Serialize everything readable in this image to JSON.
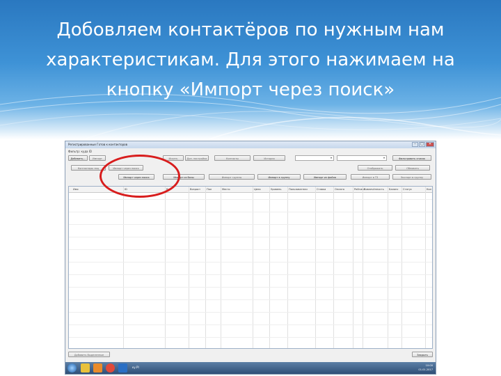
{
  "slide": {
    "title_line1": "Добовляем контактёров по нужным нам",
    "title_line2": "характеристикам. Для этого нажимаем на",
    "title_line3": "кнопку «Импорт через поиск»"
  },
  "window": {
    "title": "Регистрированные Готов к контакторов",
    "filter_label": "Фильтр: куда ID",
    "buttons": {
      "add": "Добавить...",
      "import": "Импорт",
      "search": "Искать",
      "extra1": "Доп. настройки",
      "contacts": "Контакты",
      "history": "История",
      "top_right": "Фильтровать список",
      "import_search": "Импорт через поиск",
      "contact_search": "Контактная база",
      "import_excel": "Импорт Excel",
      "group": "Группа",
      "left2": "Контакторы лиц",
      "right2a": "Отображать",
      "right2b": "Обновить",
      "bottom_left": "Добавить Выделенные",
      "close": "Закрыть",
      "sub1": "Импорт через поиск",
      "sub2": "Импорт из базы",
      "sub3": "Импорт группы",
      "sub4": "Импорт в группу",
      "sub5": "Импорт из файла",
      "sub6": "Импорт в ТЗ",
      "sub7": "Экспорт в группу"
    },
    "columns": [
      "Имя",
      "ID",
      "Воз",
      "Возраст",
      "Пол",
      "Место",
      "Цена",
      "Уровень",
      "Пользователи",
      "Ставка",
      "Оплата",
      "Рейтинг",
      "Вовлечённость",
      "Баланс",
      "Статус",
      "Кол"
    ]
  },
  "taskbar": {
    "app_label": "ку.РІ",
    "time": "10:00",
    "date": "01.01.2017"
  },
  "colors": {
    "banner_top": "#2a78c0",
    "highlight_oval": "#d81d1d",
    "taskbar": "#2f4f76"
  }
}
